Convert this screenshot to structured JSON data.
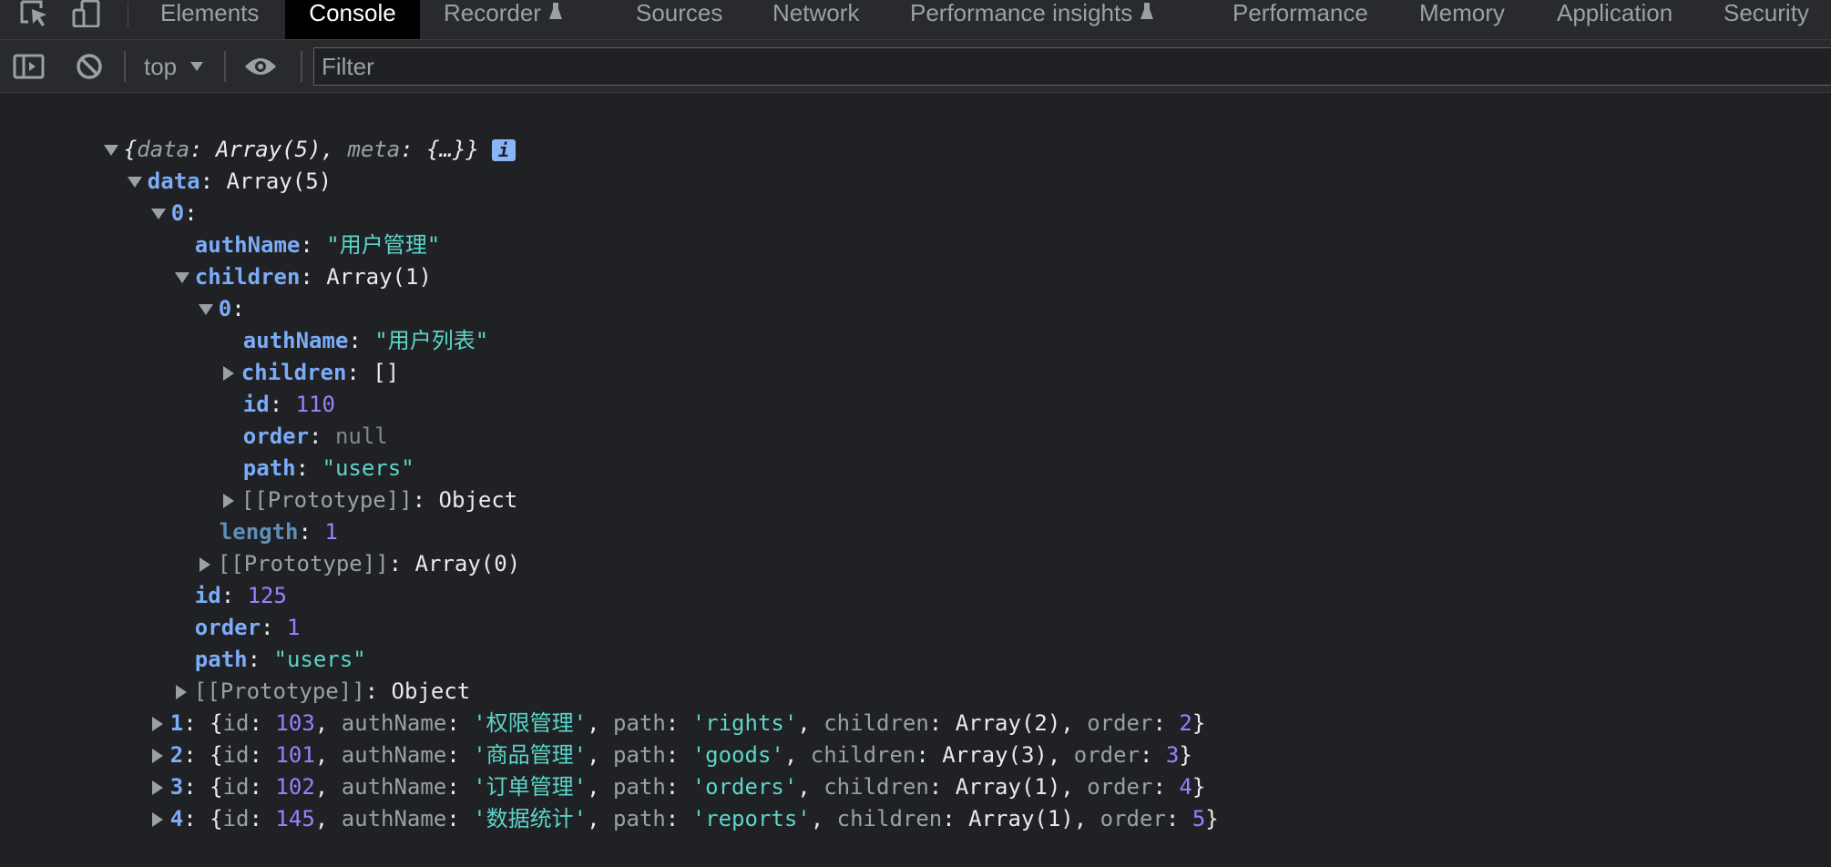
{
  "tabs": [
    {
      "label": "Elements"
    },
    {
      "label": "Console",
      "active": true
    },
    {
      "label": "Recorder",
      "experimental": true
    },
    {
      "label": "Sources"
    },
    {
      "label": "Network"
    },
    {
      "label": "Performance insights",
      "experimental": true
    },
    {
      "label": "Performance"
    },
    {
      "label": "Memory"
    },
    {
      "label": "Application"
    },
    {
      "label": "Security"
    }
  ],
  "toolbar": {
    "context": "top",
    "filter_placeholder": "Filter",
    "filter_value": ""
  },
  "console": {
    "root_preview": {
      "p1": "{",
      "k1": "data",
      "c1": ": ",
      "v1": "Array(5)",
      "sep": ", ",
      "k2": "meta",
      "c2": ": ",
      "v2": "{…}",
      "p2": "}"
    },
    "info_badge": "i",
    "data_key": "data",
    "data_val": "Array(5)",
    "item0_index": "0",
    "item0": {
      "authName_key": "authName",
      "authName_val": "\"用户管理\"",
      "children_key": "children",
      "children_val": "Array(1)",
      "child0_index": "0",
      "child0": {
        "authName_key": "authName",
        "authName_val": "\"用户列表\"",
        "children_key": "children",
        "children_val": "[]",
        "id_key": "id",
        "id_val": "110",
        "order_key": "order",
        "order_val": "null",
        "path_key": "path",
        "path_val": "\"users\"",
        "proto_key": "[[Prototype]]",
        "proto_val": "Object"
      },
      "length_key": "length",
      "length_val": "1",
      "children_proto_key": "[[Prototype]]",
      "children_proto_val": "Array(0)",
      "id_key": "id",
      "id_val": "125",
      "order_key": "order",
      "order_val": "1",
      "path_key": "path",
      "path_val": "\"users\"",
      "proto_key": "[[Prototype]]",
      "proto_val": "Object"
    },
    "collapsed_items": [
      {
        "index": "1",
        "id": "103",
        "authName": "'权限管理'",
        "path": "'rights'",
        "children": "Array(2)",
        "order": "2"
      },
      {
        "index": "2",
        "id": "101",
        "authName": "'商品管理'",
        "path": "'goods'",
        "children": "Array(3)",
        "order": "3"
      },
      {
        "index": "3",
        "id": "102",
        "authName": "'订单管理'",
        "path": "'orders'",
        "children": "Array(1)",
        "order": "4"
      },
      {
        "index": "4",
        "id": "145",
        "authName": "'数据统计'",
        "path": "'reports'",
        "children": "Array(1)",
        "order": "5"
      }
    ],
    "labels": {
      "id": "id",
      "authName": "authName",
      "path": "path",
      "children": "children",
      "order": "order"
    }
  }
}
